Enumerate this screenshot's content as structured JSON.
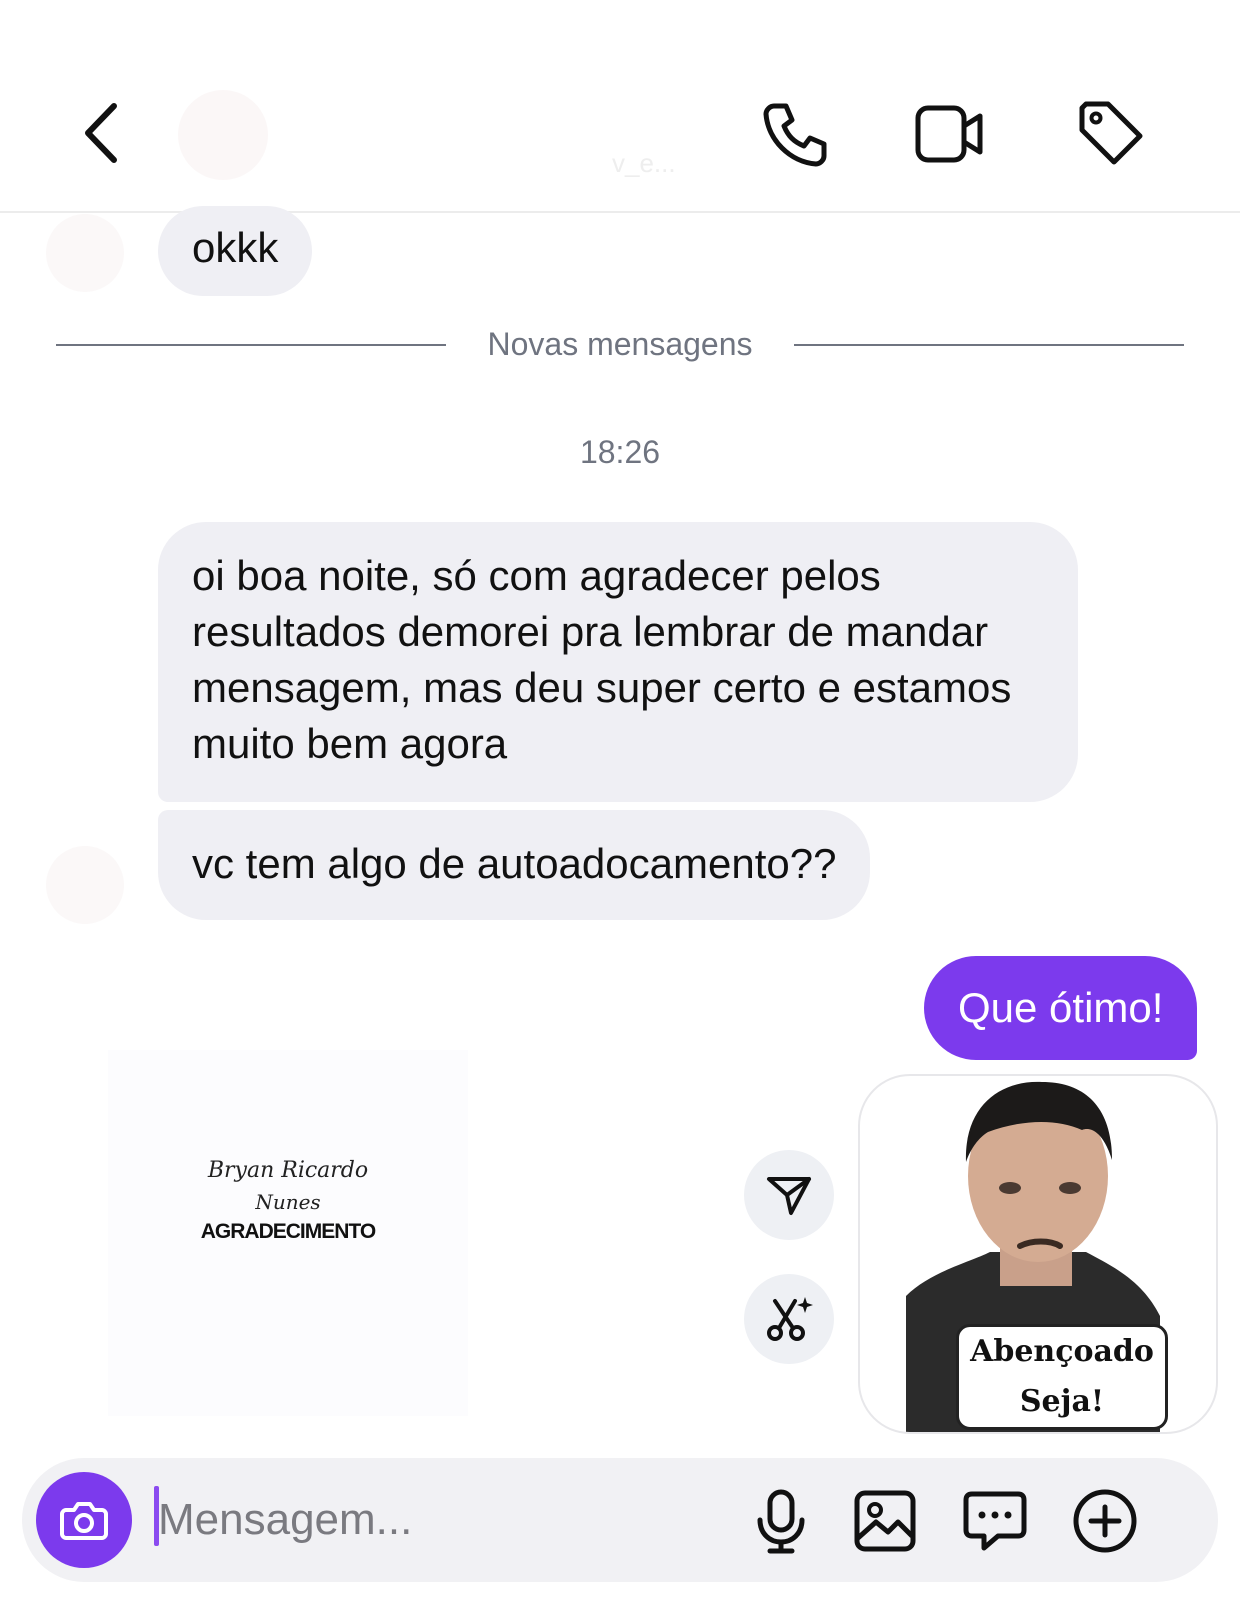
{
  "header": {
    "contact_name": "",
    "contact_username": "v_e..."
  },
  "messages": {
    "first_incoming": "okkk",
    "divider_label": "Novas mensagens",
    "timestamp": "18:26",
    "incoming_long": "oi boa noite, só com agradecer pelos resultados demorei pra lembrar de mandar mensagem, mas deu super certo e estamos muito bem agora",
    "incoming_question": "vc tem algo de autoadocamento??",
    "outgoing_reply": "Que ótimo!"
  },
  "image_message": {
    "signature_line1": "Bryan Ricardo",
    "signature_line2": "Nunes",
    "caption": "AGRADECIMENTO"
  },
  "sticker": {
    "label_line1": "Abençoado",
    "label_line2": "Seja!"
  },
  "composer": {
    "placeholder": "Mensagem..."
  },
  "icons": {
    "back": "chevron-left-icon",
    "call": "phone-icon",
    "video": "video-camera-icon",
    "tag": "tag-icon",
    "share": "send-icon",
    "ai_edit": "scissors-sparkle-icon",
    "camera": "camera-icon",
    "mic": "microphone-icon",
    "gallery": "image-icon",
    "sticker": "chat-bubble-icon",
    "more": "plus-circle-icon"
  },
  "colors": {
    "accent": "#7c3aed",
    "incoming_bubble": "#efeff4",
    "muted_text": "#6f7480"
  }
}
